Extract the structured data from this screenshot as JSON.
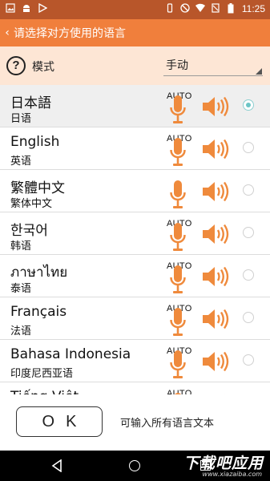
{
  "status_bar": {
    "time": "11:25",
    "left_icons": [
      "image-icon",
      "android-icon",
      "play-store-icon"
    ],
    "right_icons": [
      "no-disturb-icon",
      "wifi-icon",
      "no-sim-icon"
    ],
    "battery_icon": "battery-icon"
  },
  "header": {
    "back_glyph": "‹",
    "title": "请选择对方使用的语言"
  },
  "mode": {
    "help_glyph": "?",
    "label": "模式",
    "selected": "手动"
  },
  "languages": [
    {
      "name": "日本語",
      "native": "日语",
      "auto": "AUTO",
      "selected": true
    },
    {
      "name": "English",
      "native": "英语",
      "auto": "AUTO",
      "selected": false
    },
    {
      "name": "繁體中文",
      "native": "繁体中文",
      "auto": "",
      "selected": false
    },
    {
      "name": "한국어",
      "native": "韩语",
      "auto": "AUTO",
      "selected": false
    },
    {
      "name": "ภาษาไทย",
      "native": "泰语",
      "auto": "AUTO",
      "selected": false
    },
    {
      "name": "Français",
      "native": "法语",
      "auto": "AUTO",
      "selected": false
    },
    {
      "name": "Bahasa Indonesia",
      "native": "印度尼西亚语",
      "auto": "AUTO",
      "selected": false
    },
    {
      "name": "Tiếng Việt",
      "native": "",
      "auto": "AUTO",
      "selected": false
    }
  ],
  "footer": {
    "ok_label": "OK",
    "hint": "可输入所有语言文本"
  },
  "watermark": {
    "main": "下载吧应用",
    "sub": "www.xiazaiba.com"
  },
  "colors": {
    "accent": "#f07f3c",
    "status_bar": "#b8562a",
    "mode_bar": "#fde6d5",
    "icon_orange": "#ef8a3c",
    "radio_on": "#6cc5c6"
  }
}
